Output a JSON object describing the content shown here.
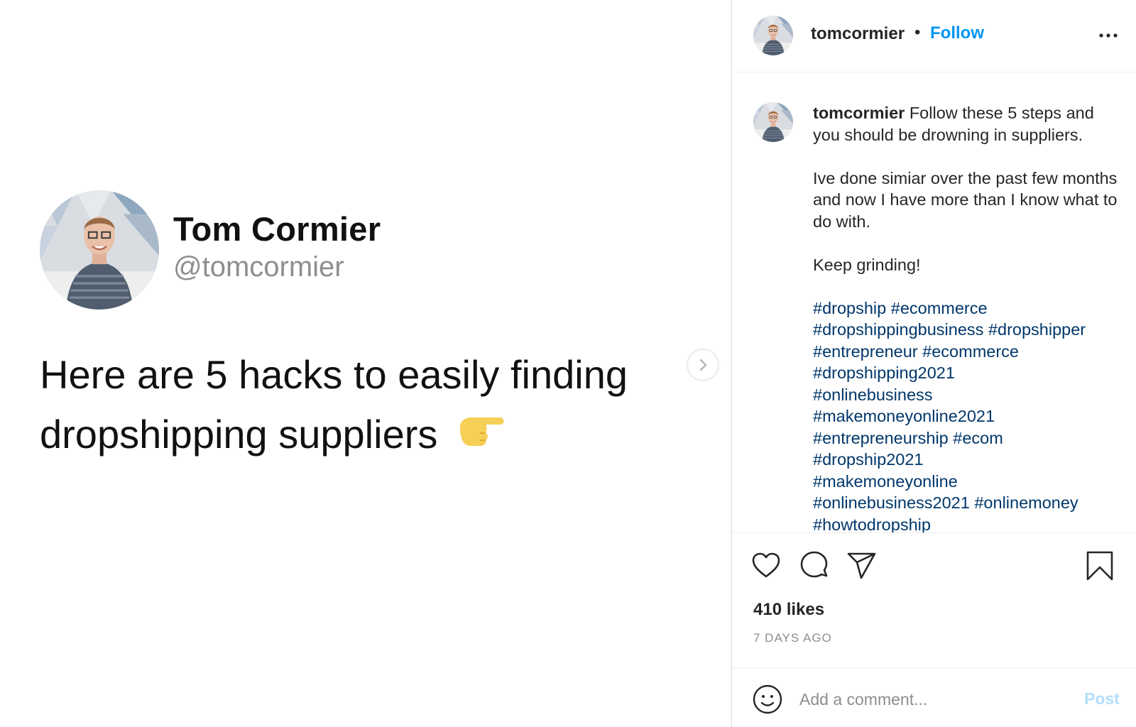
{
  "tweet": {
    "name": "Tom Cormier",
    "handle": "@tomcormier",
    "text": "Here are 5 hacks to easily finding dropshipping suppliers",
    "emoji_icon": "pointing-right-hand-icon"
  },
  "header": {
    "username": "tomcormier",
    "separator": "•",
    "follow_label": "Follow",
    "more_icon": "more-options-icon"
  },
  "caption": {
    "username": "tomcormier",
    "line1": "Follow these 5 steps and you should be drowning in suppliers.",
    "line2": "Ive done simiar over the past few months and now I have more than I know what to do with.",
    "line3": "Keep grinding!",
    "hashtags": [
      "#dropship",
      "#ecommerce",
      "#dropshippingbusiness",
      "#dropshipper",
      "#entrepreneur",
      "#ecommerce",
      "#dropshipping2021",
      "#onlinebusiness",
      "#makemoneyonline2021",
      "#entrepreneurship",
      "#ecom",
      "#dropship2021",
      "#makemoneyonline",
      "#onlinebusiness2021",
      "#onlinemoney",
      "#howtodropship"
    ]
  },
  "actions": {
    "icons": [
      "heart-icon",
      "comment-icon",
      "share-icon",
      "bookmark-icon"
    ],
    "likes": "410 likes",
    "time": "7 DAYS AGO"
  },
  "comment": {
    "placeholder": "Add a comment...",
    "post_label": "Post"
  },
  "colors": {
    "link_blue": "#0095f6",
    "hashtag": "#00376b",
    "post_disabled": "#b2dffc",
    "muted": "#8e8e8e"
  }
}
